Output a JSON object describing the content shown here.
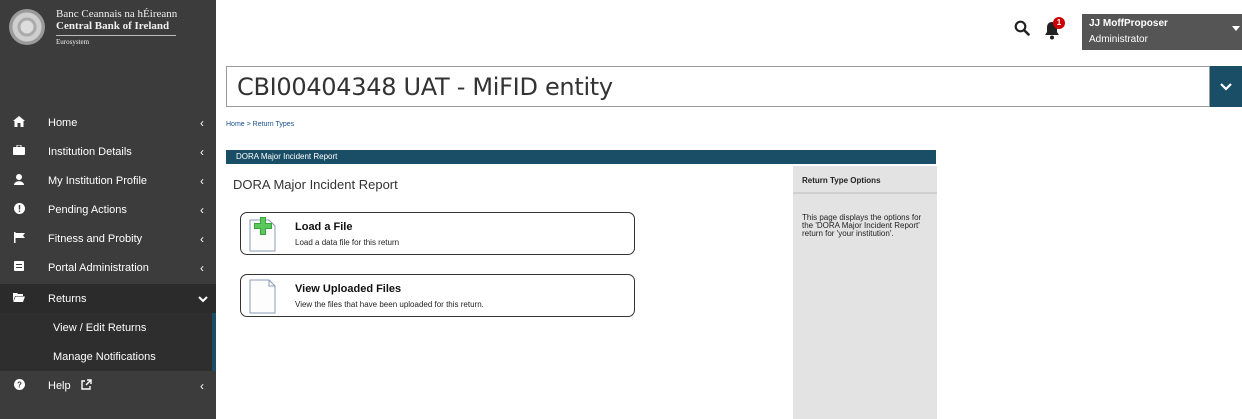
{
  "brand": {
    "line1": "Banc Ceannais na hÉireann",
    "line2": "Central Bank of Ireland",
    "line3": "Eurosystem"
  },
  "sidebar": {
    "items": [
      {
        "label": "Home",
        "icon": "home-icon"
      },
      {
        "label": "Institution Details",
        "icon": "briefcase-icon"
      },
      {
        "label": "My Institution Profile",
        "icon": "user-icon"
      },
      {
        "label": "Pending Actions",
        "icon": "info-icon"
      },
      {
        "label": "Fitness and Probity",
        "icon": "flag-icon"
      },
      {
        "label": "Portal Administration",
        "icon": "list-icon"
      },
      {
        "label": "Returns",
        "icon": "folder-open-icon"
      },
      {
        "label": "View / Edit Returns"
      },
      {
        "label": "Manage Notifications"
      },
      {
        "label": "Help",
        "icon": "question-icon"
      }
    ]
  },
  "header": {
    "notification_count": "1",
    "user_name": "JJ MoffProposer",
    "user_role": "Administrator"
  },
  "entity": {
    "title": "CBI00404348 UAT - MiFID entity"
  },
  "breadcrumb": "Home > Return Types",
  "panel": {
    "header": "DORA Major Incident Report",
    "title": "DORA Major Incident Report"
  },
  "cards": [
    {
      "title": "Load a File",
      "description": "Load a data file for this return"
    },
    {
      "title": "View Uploaded Files",
      "description": "View the files that have been uploaded for this return."
    }
  ],
  "options": {
    "title": "Return Type Options",
    "text": "This page displays the options for the 'DORA Major Incident Report' return for 'your institution'."
  },
  "colors": {
    "sidebar": "#3c3c3c",
    "accent": "#1a4e66",
    "badge": "#cc0000"
  }
}
